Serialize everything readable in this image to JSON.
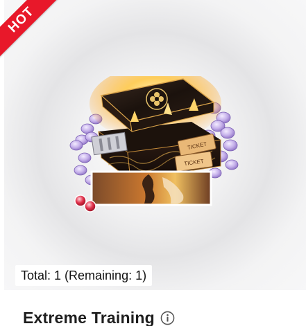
{
  "badge": {
    "label": "HOT",
    "color": "#e8182a"
  },
  "product": {
    "image_icon": "treasure-chest-bundle-image",
    "availability": "Total: 1 (Remaining: 1)",
    "title": "Extreme Training",
    "info_icon": "info-icon"
  },
  "colors": {
    "badge": "#e8182a",
    "title": "#1e1e1e",
    "chest_gold": "#e8a73a",
    "coin_purple": "#b9a3e0"
  }
}
